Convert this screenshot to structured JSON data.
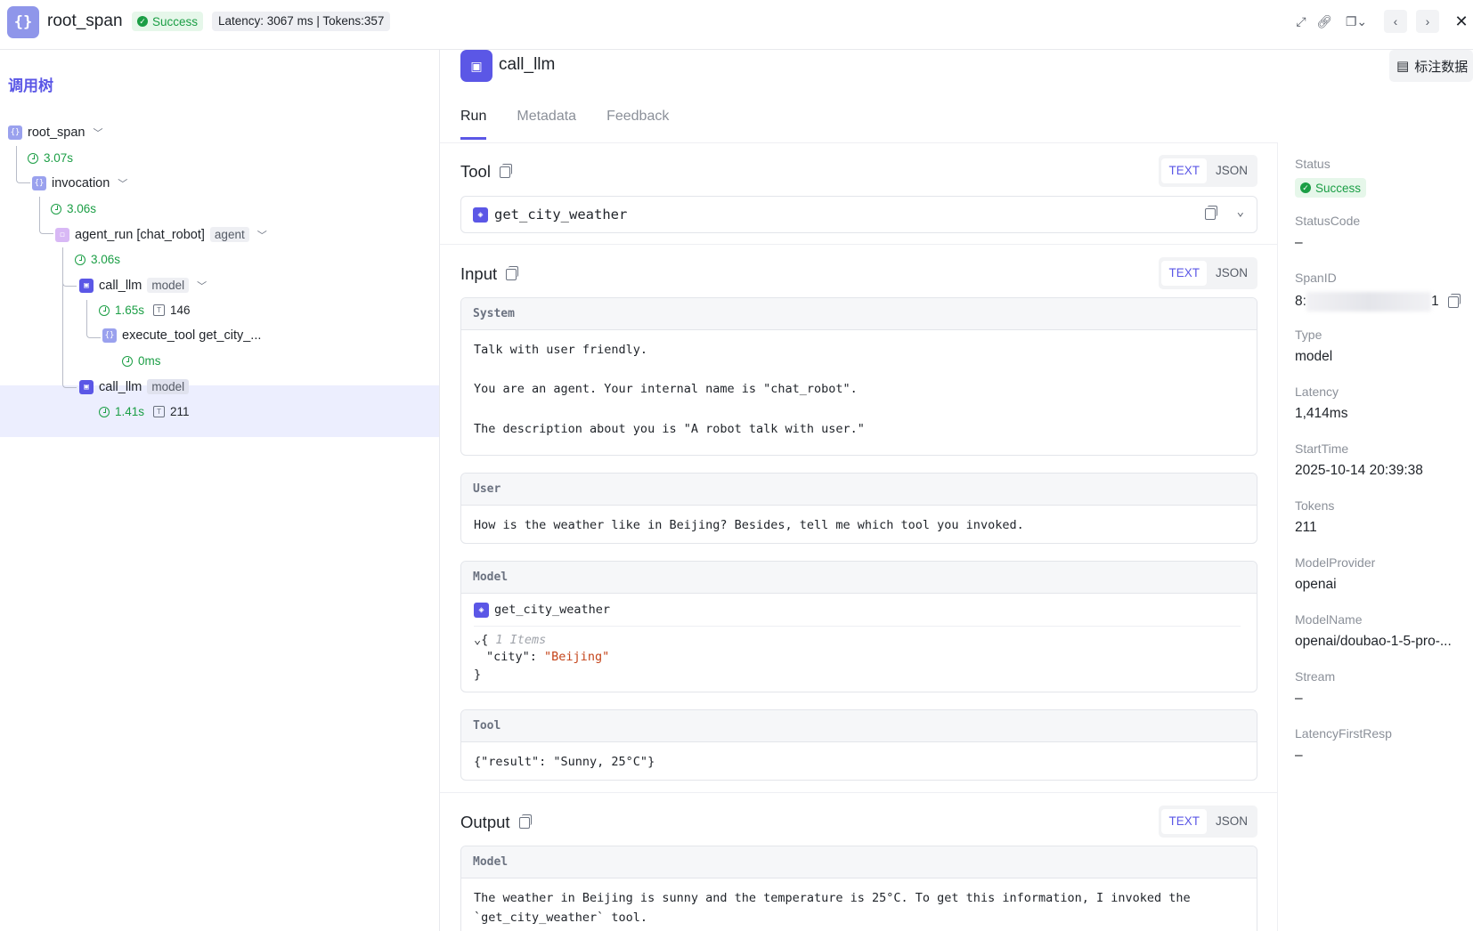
{
  "header": {
    "title": "root_span",
    "status": "Success",
    "metrics": "Latency: 3067 ms | Tokens:357"
  },
  "tree": {
    "title": "调用树",
    "nodes": [
      {
        "label": "root_span",
        "time": "3.07s"
      },
      {
        "label": "invocation",
        "time": "3.06s"
      },
      {
        "label": "agent_run [chat_robot]",
        "tag": "agent",
        "time": "3.06s"
      },
      {
        "label": "call_llm",
        "tag": "model",
        "time": "1.65s",
        "tokens": "146"
      },
      {
        "label": "execute_tool get_city_...",
        "time": "0ms"
      },
      {
        "label": "call_llm",
        "tag": "model",
        "time": "1.41s",
        "tokens": "211"
      }
    ]
  },
  "detail": {
    "title": "call_llm",
    "tabs": [
      "Run",
      "Metadata",
      "Feedback"
    ],
    "toggle": {
      "text": "TEXT",
      "json": "JSON"
    },
    "tool_section": {
      "title": "Tool",
      "name": "get_city_weather"
    },
    "input_section": {
      "title": "Input",
      "system": {
        "label": "System",
        "lines": [
          "Talk with user friendly.",
          "You are an agent. Your internal name is \"chat_robot\".",
          "The description about you is \"A robot talk with user.\""
        ]
      },
      "user": {
        "label": "User",
        "text": "How is the weather like in Beijing? Besides, tell me which tool you invoked."
      },
      "model": {
        "label": "Model",
        "tool": "get_city_weather",
        "items_comment": "1 Items",
        "key": "\"city\"",
        "value": "\"Beijing\""
      },
      "tool": {
        "label": "Tool",
        "text": "{\"result\": \"Sunny, 25°C\"}"
      }
    },
    "output_section": {
      "title": "Output",
      "model": {
        "label": "Model",
        "line1": "The weather in Beijing is sunny and the temperature is 25°C. To get this information, I invoked the",
        "line2": "`get_city_weather` tool."
      }
    }
  },
  "props": {
    "mark_button": "标注数据",
    "status_label": "Status",
    "status_value": "Success",
    "statuscode_label": "StatusCode",
    "statuscode_value": "–",
    "spanid_label": "SpanID",
    "spanid_prefix": "8:",
    "spanid_suffix": "1",
    "type_label": "Type",
    "type_value": "model",
    "latency_label": "Latency",
    "latency_value": "1,414ms",
    "starttime_label": "StartTime",
    "starttime_value": "2025-10-14 20:39:38",
    "tokens_label": "Tokens",
    "tokens_value": "211",
    "provider_label": "ModelProvider",
    "provider_value": "openai",
    "modelname_label": "ModelName",
    "modelname_value": "openai/doubao-1-5-pro-...",
    "stream_label": "Stream",
    "stream_value": "–",
    "lfr_label": "LatencyFirstResp",
    "lfr_value": "–"
  },
  "colors": {
    "accent": "#5b57e6",
    "success": "#1b9e45"
  }
}
